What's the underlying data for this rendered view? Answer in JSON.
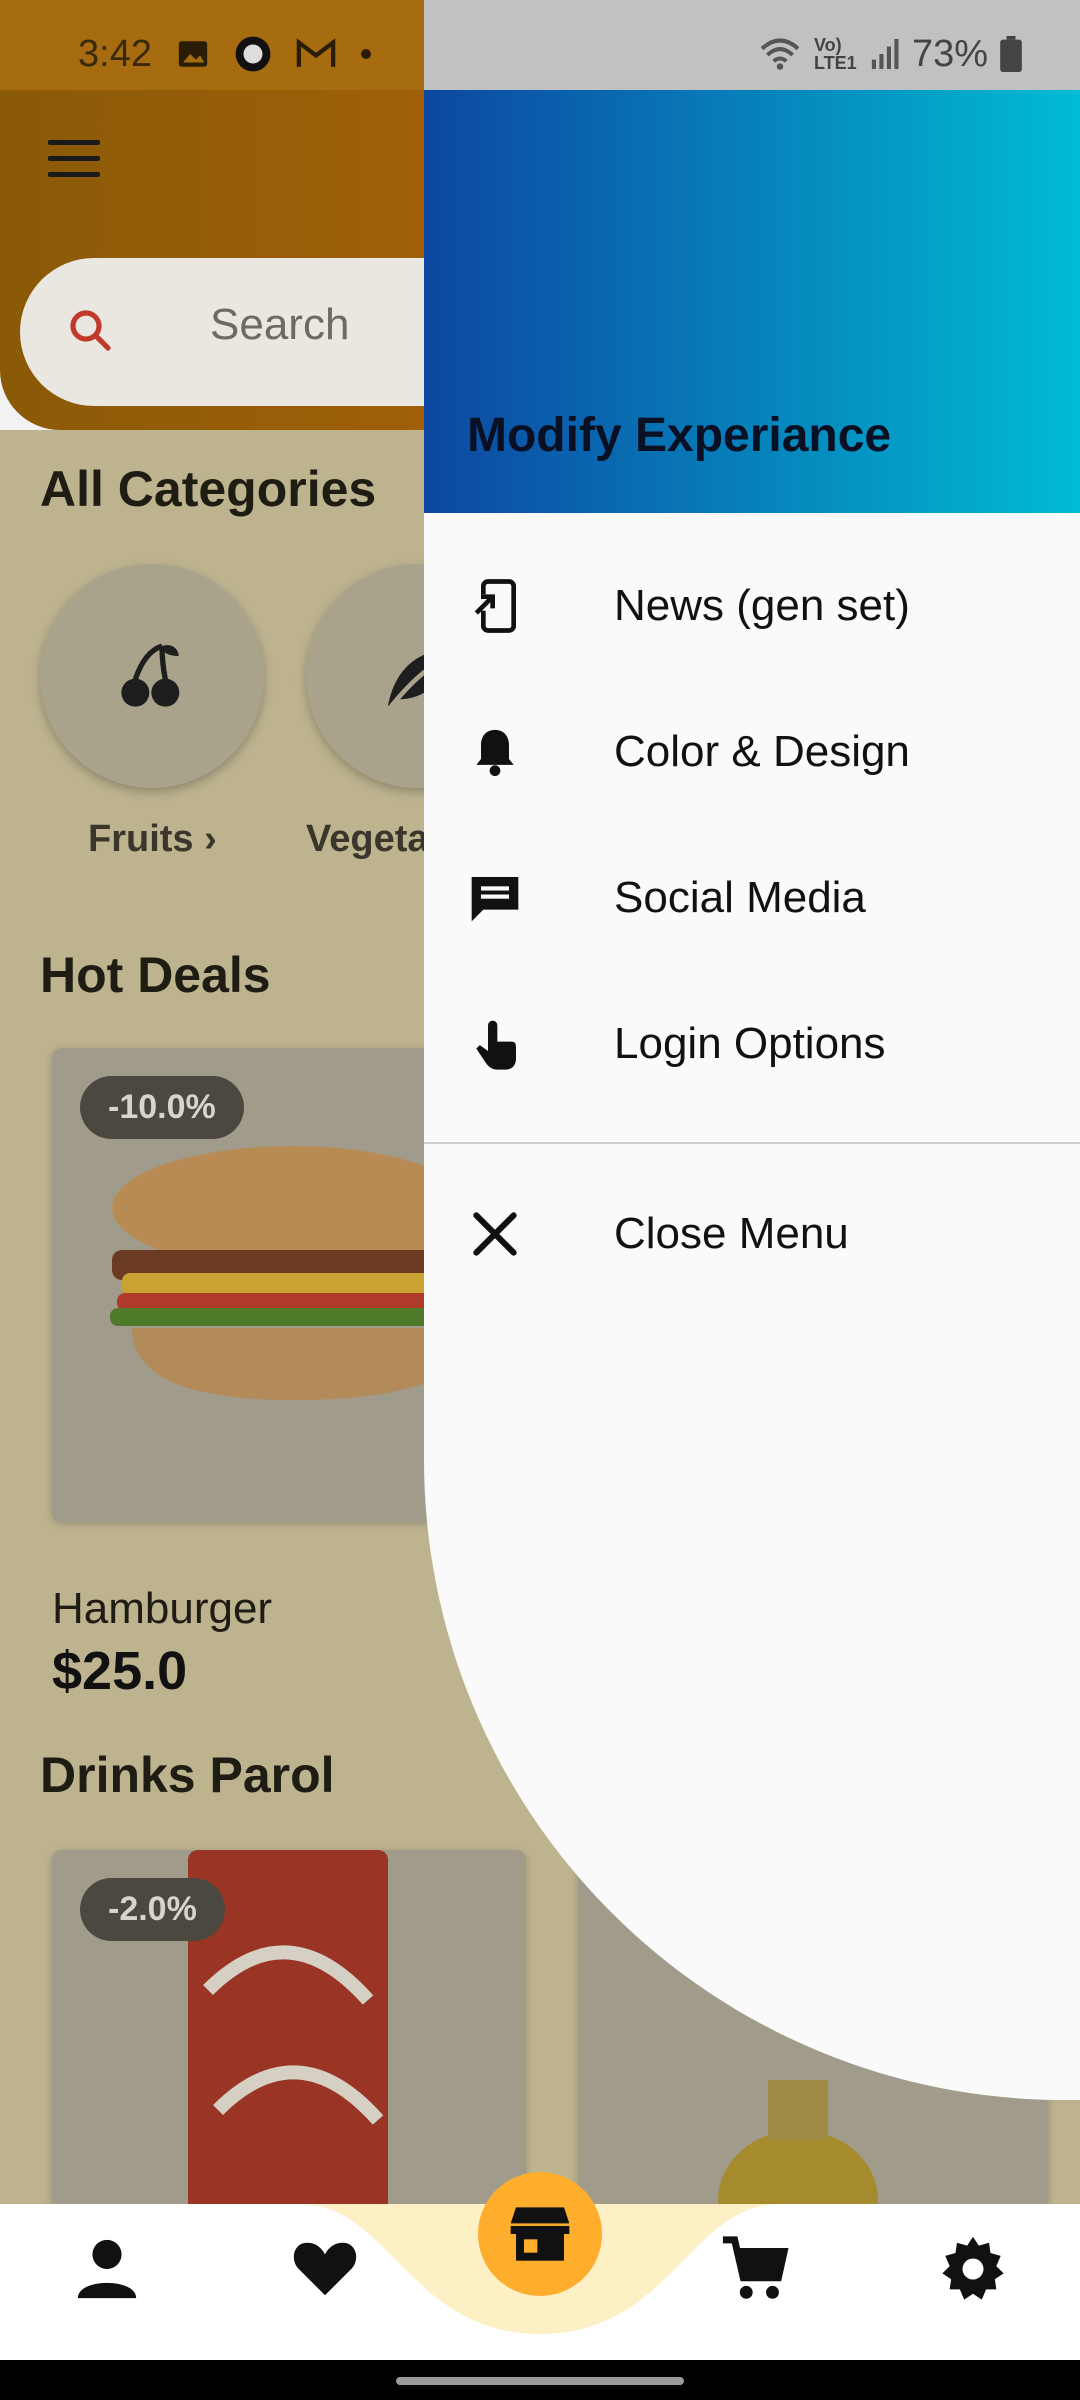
{
  "status": {
    "time": "3:42",
    "battery": "73%",
    "network": "Vo) LTE1"
  },
  "search": {
    "placeholder": "Search"
  },
  "sections": {
    "categories_title": "All Categories",
    "hot_deals_title": "Hot Deals",
    "drinks_title": "Drinks Parol"
  },
  "categories": [
    {
      "label": "Fruits ›",
      "icon": "cherry-icon"
    },
    {
      "label": "Vegeta",
      "icon": "leaf-icon"
    }
  ],
  "hot_deal": {
    "discount": "-10.0%",
    "name": "Hamburger",
    "price": "$25.0"
  },
  "drink": {
    "discount": "-2.0%"
  },
  "drawer": {
    "title": "Modify Experiance",
    "items": [
      {
        "label": "News (gen set)",
        "icon": "phone-arrow-icon"
      },
      {
        "label": "Color & Design",
        "icon": "bell-icon"
      },
      {
        "label": "Social Media",
        "icon": "chat-icon"
      },
      {
        "label": "Login Options",
        "icon": "touch-icon"
      }
    ],
    "close_label": "Close Menu"
  },
  "bottom_nav": [
    "person-icon",
    "heart-icon",
    "store-icon",
    "cart-icon",
    "gear-icon"
  ],
  "colors": {
    "accent": "#ffad2d",
    "header_gradient_start": "#0d47a1",
    "header_gradient_end": "#00bcd4"
  }
}
